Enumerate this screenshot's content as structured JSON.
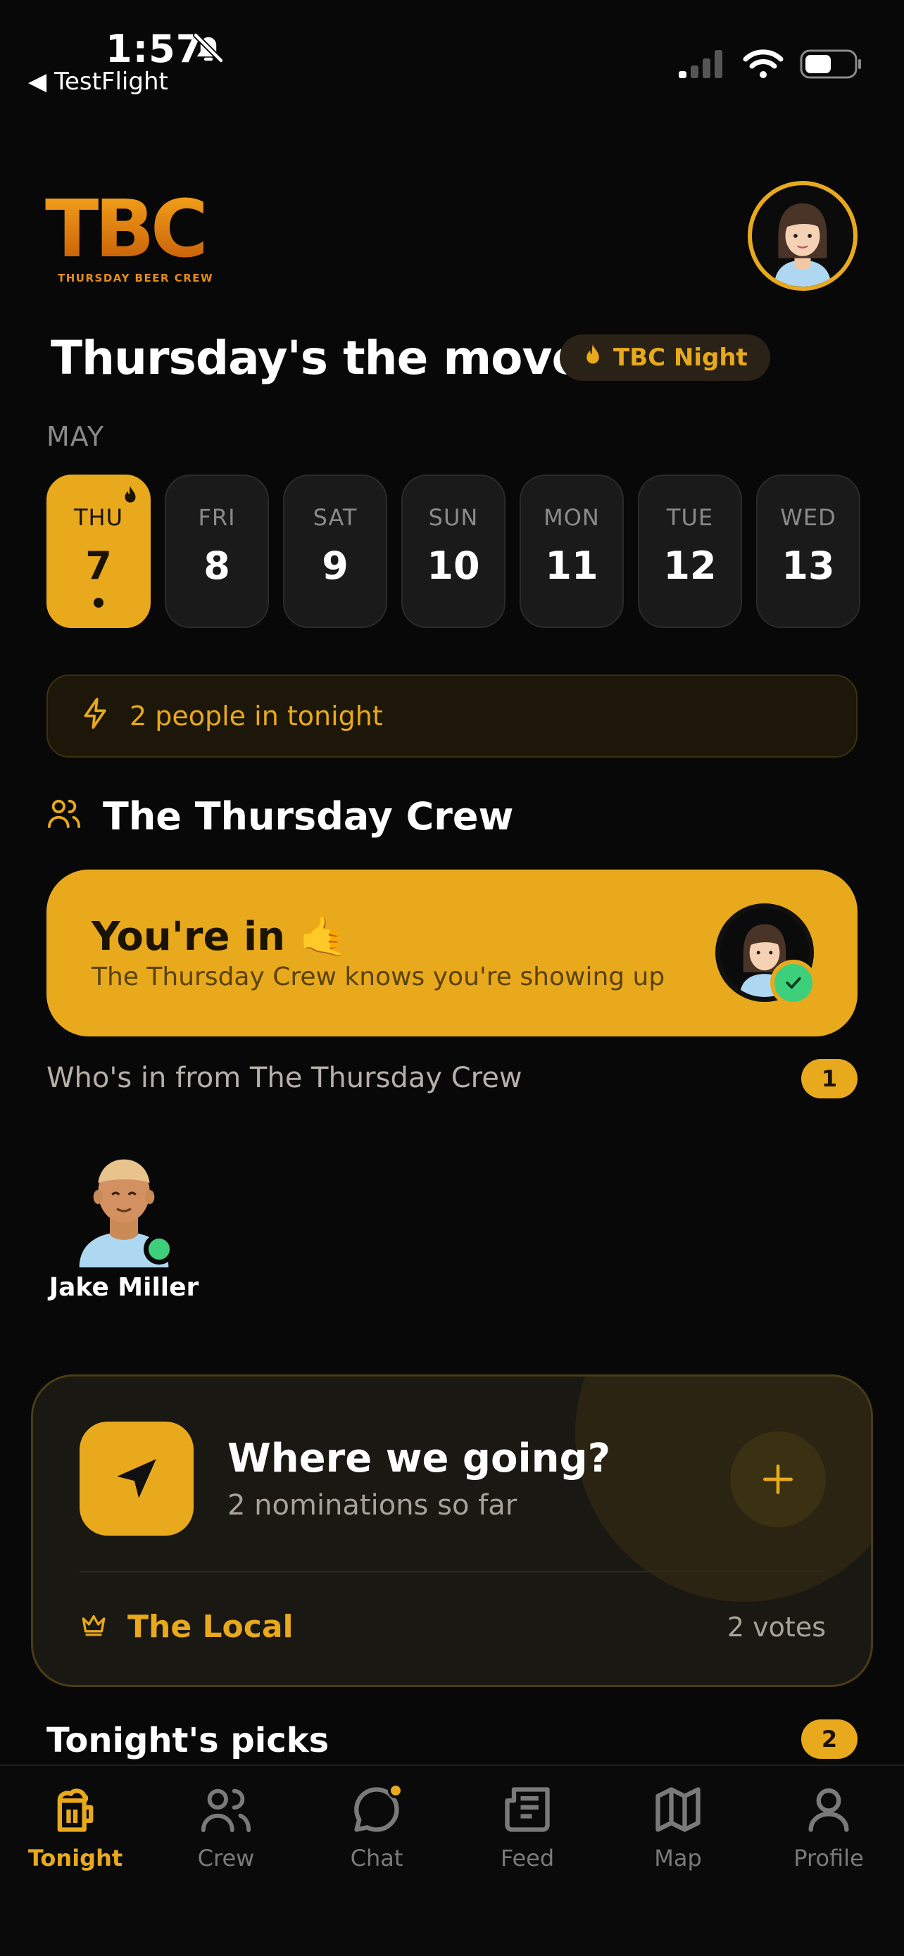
{
  "status_bar": {
    "time": "1:57",
    "back_label": "◀ TestFlight"
  },
  "brand": {
    "logo_text": "TBC",
    "logo_sub": "THURSDAY BEER CREW"
  },
  "header": {
    "headline": "Thursday's the move.",
    "night_pill": "TBC Night"
  },
  "calendar": {
    "month": "MAY",
    "days": [
      {
        "name": "THU",
        "date": "7"
      },
      {
        "name": "FRI",
        "date": "8"
      },
      {
        "name": "SAT",
        "date": "9"
      },
      {
        "name": "SUN",
        "date": "10"
      },
      {
        "name": "MON",
        "date": "11"
      },
      {
        "name": "TUE",
        "date": "12"
      },
      {
        "name": "WED",
        "date": "13"
      }
    ]
  },
  "tonight_banner": "2 people in tonight",
  "crew": {
    "title": "The Thursday Crew",
    "status_title": "You're in 🤙",
    "status_subtitle": "The Thursday Crew knows you're showing up",
    "whos_in_label": "Who's in from The Thursday Crew",
    "whos_in_count": "1",
    "members": [
      {
        "name": "Jake Miller"
      }
    ]
  },
  "venue": {
    "title": "Where we going?",
    "subtitle": "2 nominations so far",
    "top_pick": "The Local",
    "top_votes": "2 votes"
  },
  "picks": {
    "title": "Tonight's picks",
    "count": "2"
  },
  "tabs": [
    {
      "label": "Tonight"
    },
    {
      "label": "Crew"
    },
    {
      "label": "Chat"
    },
    {
      "label": "Feed"
    },
    {
      "label": "Map"
    },
    {
      "label": "Profile"
    }
  ],
  "colors": {
    "accent": "#e8a91d",
    "online": "#3ecf7b",
    "background": "#080808"
  }
}
